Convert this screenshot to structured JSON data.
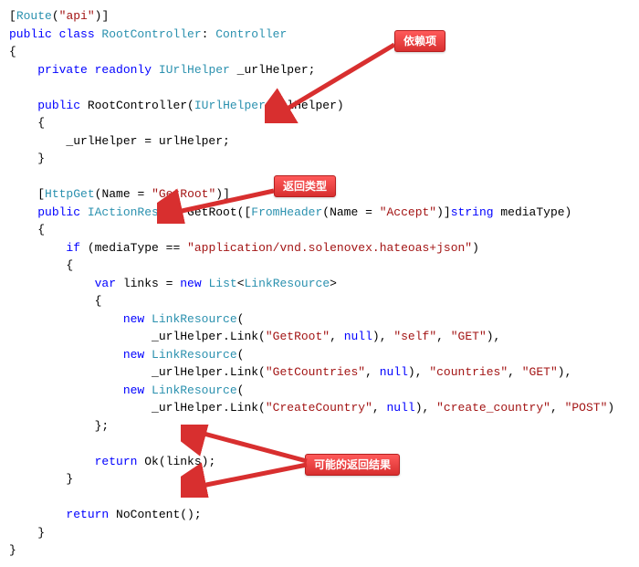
{
  "annotations": {
    "dep": "依赖项",
    "ret_type": "返回类型",
    "possible": "可能的返回结果"
  },
  "code": {
    "l01a": "Route",
    "l01b": "\"api\"",
    "l02a": "public class ",
    "l02b": "RootController",
    "l02c": ": ",
    "l02d": "Controller",
    "l04a": "private readonly ",
    "l04b": "IUrlHelper",
    "l04c": " _urlHelper;",
    "l05a": "public ",
    "l05b": "RootController(",
    "l05c": "IUrlHelper",
    "l05d": " urlHelper)",
    "l07a": "        _urlHelper = urlHelper;",
    "l09a": "HttpGet",
    "l09b": "(Name = ",
    "l09c": "\"GetRoot\"",
    "l09d": ")",
    "l10a": "public ",
    "l10b": "IActionResult",
    "l10c": " GetRoot([",
    "l10d": "FromHeader",
    "l10e": "(Name = ",
    "l10f": "\"Accept\"",
    "l10g": ")]",
    "l10h": "string",
    "l10i": " mediaType)",
    "l12a": "if",
    "l12b": " (mediaType == ",
    "l12c": "\"application/vnd.solenovex.hateoas+json\"",
    "l12d": ")",
    "l14a": "var",
    "l14b": " links = ",
    "l14c": "new ",
    "l14d": "List",
    "l14e": "<",
    "l14f": "LinkResource",
    "l14g": ">",
    "l16a": "new ",
    "l16b": "LinkResource",
    "l16c": "(",
    "l17a": "                    _urlHelper.Link(",
    "l17b": "\"GetRoot\"",
    "l17c": ", ",
    "l17d": "null",
    "l17e": "), ",
    "l17f": "\"self\"",
    "l17g": ", ",
    "l17h": "\"GET\"",
    "l17i": "),",
    "l18a": "new ",
    "l18b": "LinkResource",
    "l18c": "(",
    "l19a": "                    _urlHelper.Link(",
    "l19b": "\"GetCountries\"",
    "l19c": ", ",
    "l19d": "null",
    "l19e": "), ",
    "l19f": "\"countries\"",
    "l19g": ", ",
    "l19h": "\"GET\"",
    "l19i": "),",
    "l20a": "new ",
    "l20b": "LinkResource",
    "l20c": "(",
    "l21a": "                    _urlHelper.Link(",
    "l21b": "\"CreateCountry\"",
    "l21c": ", ",
    "l21d": "null",
    "l21e": "), ",
    "l21f": "\"create_country\"",
    "l21g": ", ",
    "l21h": "\"POST\"",
    "l21i": ")",
    "l24a": "return",
    "l24b": " Ok(links);",
    "l27a": "return",
    "l27b": " NoContent();"
  }
}
